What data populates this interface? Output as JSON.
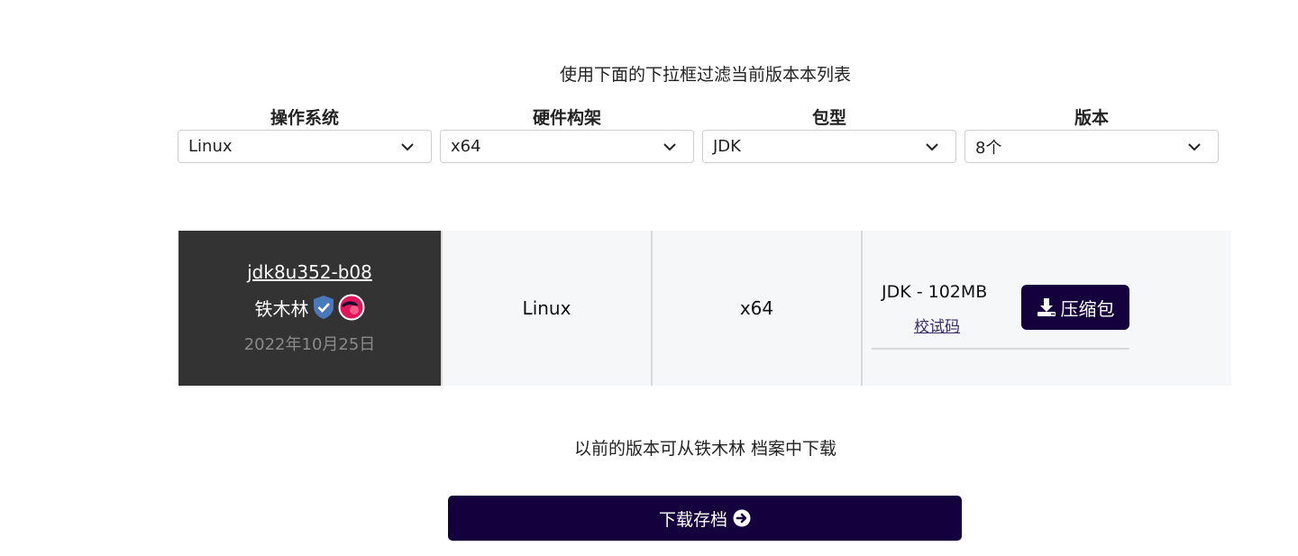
{
  "instructions": "使用下面的下拉框过滤当前版本本列表",
  "filters": [
    {
      "label": "操作系统",
      "value": "Linux"
    },
    {
      "label": "硬件构架",
      "value": "x64"
    },
    {
      "label": "包型",
      "value": "JDK"
    },
    {
      "label": "版本",
      "value": "8个"
    }
  ],
  "release": {
    "name": "jdk8u352-b08",
    "vendor": "铁木林",
    "date": "2022年10月25日",
    "os": "Linux",
    "arch": "x64",
    "package_label": "JDK - 102MB",
    "checksum_label": "校试码",
    "archive_button_label": "压缩包"
  },
  "previous_note": "以前的版本可从铁木林 档案中下载",
  "archive_download_label": "下载存档",
  "colors": {
    "primary": "#14003c",
    "dark_cell": "#333333",
    "row_bg": "#f6f7f9",
    "verified_badge": "#4a78b8",
    "vendor_logo": "#e0155a"
  }
}
